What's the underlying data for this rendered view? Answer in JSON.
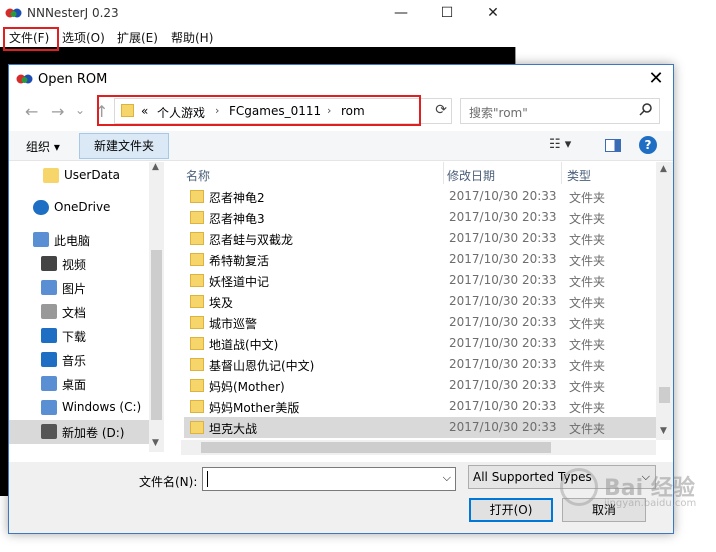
{
  "app": {
    "title": "NNNesterJ 0.23",
    "controls": [
      "—",
      "☐",
      "✕"
    ],
    "menu": [
      "文件(F)",
      "选项(O)",
      "扩展(E)",
      "帮助(H)"
    ]
  },
  "dialog": {
    "title": "Open ROM",
    "close": "✕",
    "nav": {
      "back": "←",
      "forward": "→",
      "recent": "⌄",
      "up": "↑"
    },
    "breadcrumb": [
      "«",
      "个人游戏",
      "FCgames_0111",
      "rom"
    ],
    "crumb_sep": "›",
    "search_placeholder": "搜索\"rom\"",
    "toolbar": {
      "organize": "组织 ▾",
      "new_folder": "新建文件夹",
      "view": "☷ ▾",
      "help": "?"
    },
    "nav_items": [
      {
        "label": "UserData",
        "icon": "folder-icon",
        "color": "#f6d66b"
      },
      {
        "label": "OneDrive",
        "icon": "cloud-icon",
        "color": "#1e6fc4"
      },
      {
        "label": "此电脑",
        "icon": "computer-icon",
        "color": "#5a8fd4"
      },
      {
        "label": "视频",
        "icon": "video-icon",
        "color": "#444"
      },
      {
        "label": "图片",
        "icon": "pictures-icon",
        "color": "#5a8fd4"
      },
      {
        "label": "文档",
        "icon": "documents-icon",
        "color": "#999"
      },
      {
        "label": "下载",
        "icon": "download-icon",
        "color": "#1e6fc4"
      },
      {
        "label": "音乐",
        "icon": "music-icon",
        "color": "#1e6fc4"
      },
      {
        "label": "桌面",
        "icon": "desktop-icon",
        "color": "#5a8fd4"
      },
      {
        "label": "Windows (C:)",
        "icon": "drive-c-icon",
        "color": "#5a8fd4"
      },
      {
        "label": "新加卷 (D:)",
        "icon": "drive-d-icon",
        "color": "#555"
      }
    ],
    "columns": {
      "name": "名称",
      "date": "修改日期",
      "type": "类型"
    },
    "files": [
      {
        "name": "忍者神龟2",
        "date": "2017/10/30 20:33",
        "type": "文件夹"
      },
      {
        "name": "忍者神龟3",
        "date": "2017/10/30 20:33",
        "type": "文件夹"
      },
      {
        "name": "忍者蛙与双截龙",
        "date": "2017/10/30 20:33",
        "type": "文件夹"
      },
      {
        "name": "希特勒复活",
        "date": "2017/10/30 20:33",
        "type": "文件夹"
      },
      {
        "name": "妖怪道中记",
        "date": "2017/10/30 20:33",
        "type": "文件夹"
      },
      {
        "name": "埃及",
        "date": "2017/10/30 20:33",
        "type": "文件夹"
      },
      {
        "name": "城市巡警",
        "date": "2017/10/30 20:33",
        "type": "文件夹"
      },
      {
        "name": "地道战(中文)",
        "date": "2017/10/30 20:33",
        "type": "文件夹"
      },
      {
        "name": "基督山恩仇记(中文)",
        "date": "2017/10/30 20:33",
        "type": "文件夹"
      },
      {
        "name": "妈妈(Mother)",
        "date": "2017/10/30 20:33",
        "type": "文件夹"
      },
      {
        "name": "妈妈Mother美版",
        "date": "2017/10/30 20:33",
        "type": "文件夹"
      },
      {
        "name": "坦克大战",
        "date": "2017/10/30 20:33",
        "type": "文件夹"
      }
    ],
    "selected_index": 11,
    "filename_label": "文件名(N):",
    "filename_value": "",
    "filetype": "All Supported Types",
    "open_label": "打开(O)",
    "cancel_label": "取消"
  },
  "watermark": {
    "text": "Bai 经验",
    "sub": "jingyan.baidu.com"
  },
  "colors": {
    "highlight_red": "#e02020",
    "accent_blue": "#0078d7",
    "folder_yellow": "#f6d66b",
    "selected_row": "#d9d9d9"
  }
}
